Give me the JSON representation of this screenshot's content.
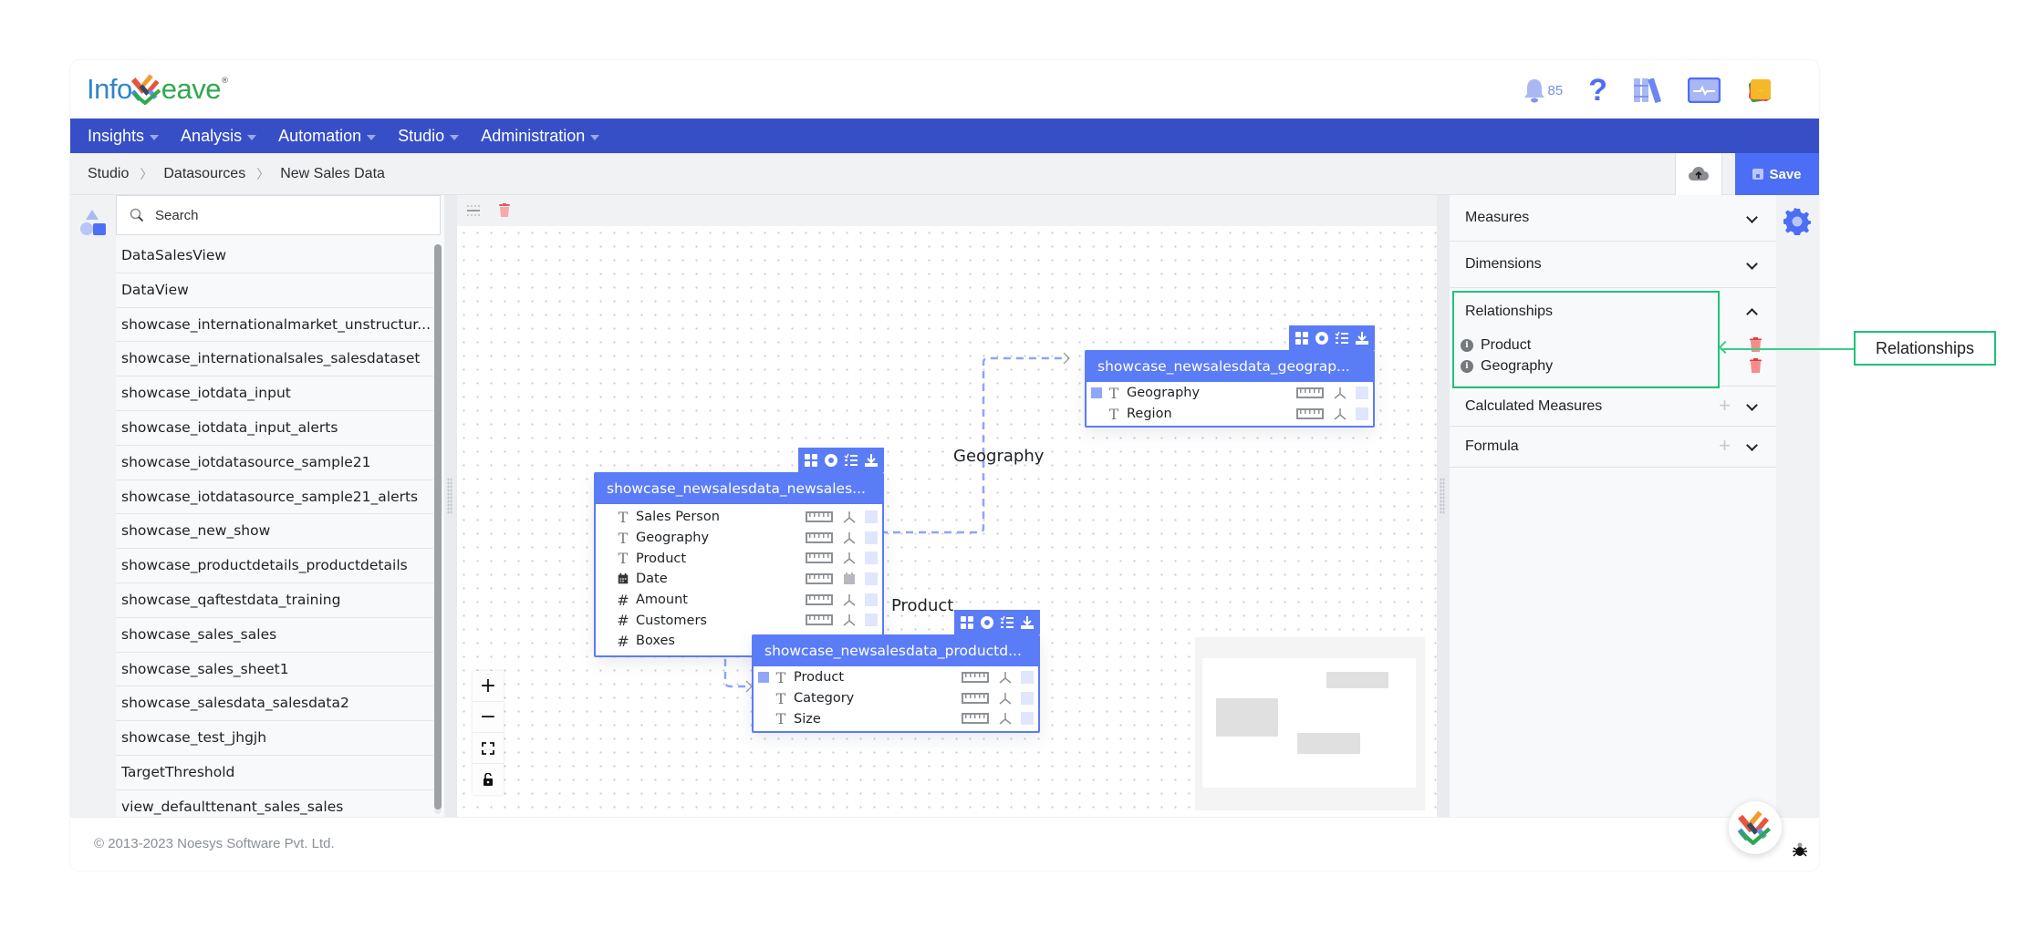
{
  "app": {
    "logo_text_left": "Info",
    "logo_text_right": "eave",
    "logo_reg": "®",
    "notifications_count": "85",
    "help_glyph": "?"
  },
  "nav": {
    "items": [
      {
        "label": "Insights"
      },
      {
        "label": "Analysis"
      },
      {
        "label": "Automation"
      },
      {
        "label": "Studio"
      },
      {
        "label": "Administration"
      }
    ]
  },
  "breadcrumb": {
    "items": [
      "Studio",
      "Datasources",
      "New Sales Data"
    ],
    "separator": "〉"
  },
  "toolbar": {
    "save_label": "Save"
  },
  "search": {
    "placeholder": "Search",
    "value": ""
  },
  "datasources": [
    "DataSalesView",
    "DataView",
    "showcase_internationalmarket_unstructur...",
    "showcase_internationalsales_salesdataset",
    "showcase_iotdata_input",
    "showcase_iotdata_input_alerts",
    "showcase_iotdatasource_sample21",
    "showcase_iotdatasource_sample21_alerts",
    "showcase_new_show",
    "showcase_productdetails_productdetails",
    "showcase_qaftestdata_training",
    "showcase_sales_sales",
    "showcase_sales_sheet1",
    "showcase_salesdata_salesdata2",
    "showcase_test_jhgjh",
    "TargetThreshold",
    "view_defaulttenant_sales_sales"
  ],
  "entities": {
    "sales": {
      "title": "showcase_newsalesdata_newsales...",
      "fields": [
        {
          "name": "Sales Person",
          "type": "text"
        },
        {
          "name": "Geography",
          "type": "text"
        },
        {
          "name": "Product",
          "type": "text"
        },
        {
          "name": "Date",
          "type": "date"
        },
        {
          "name": "Amount",
          "type": "number"
        },
        {
          "name": "Customers",
          "type": "number"
        },
        {
          "name": "Boxes",
          "type": "number"
        }
      ]
    },
    "geography": {
      "title": "showcase_newsalesdata_geograp...",
      "fields": [
        {
          "name": "Geography",
          "type": "text",
          "selected": true
        },
        {
          "name": "Region",
          "type": "text"
        }
      ]
    },
    "product": {
      "title": "showcase_newsalesdata_productd...",
      "fields": [
        {
          "name": "Product",
          "type": "text",
          "selected": true
        },
        {
          "name": "Category",
          "type": "text"
        },
        {
          "name": "Size",
          "type": "text"
        }
      ]
    }
  },
  "canvas": {
    "relationship_labels": [
      "Geography",
      "Product"
    ],
    "zoom_controls": [
      "+",
      "−"
    ]
  },
  "rightpanel": {
    "sections": {
      "measures": "Measures",
      "dimensions": "Dimensions",
      "relationships": "Relationships",
      "calculated_measures": "Calculated Measures",
      "formula": "Formula"
    },
    "relationships": [
      "Product",
      "Geography"
    ]
  },
  "callout": {
    "label": "Relationships",
    "color": "#1fc27b"
  },
  "footer": {
    "copyright": "© 2013-2023 Noesys Software Pvt. Ltd."
  },
  "colors": {
    "nav": "#364fc7",
    "accent": "#4c6ef5",
    "entity": "#5b7cf7",
    "danger": "#f06565"
  }
}
